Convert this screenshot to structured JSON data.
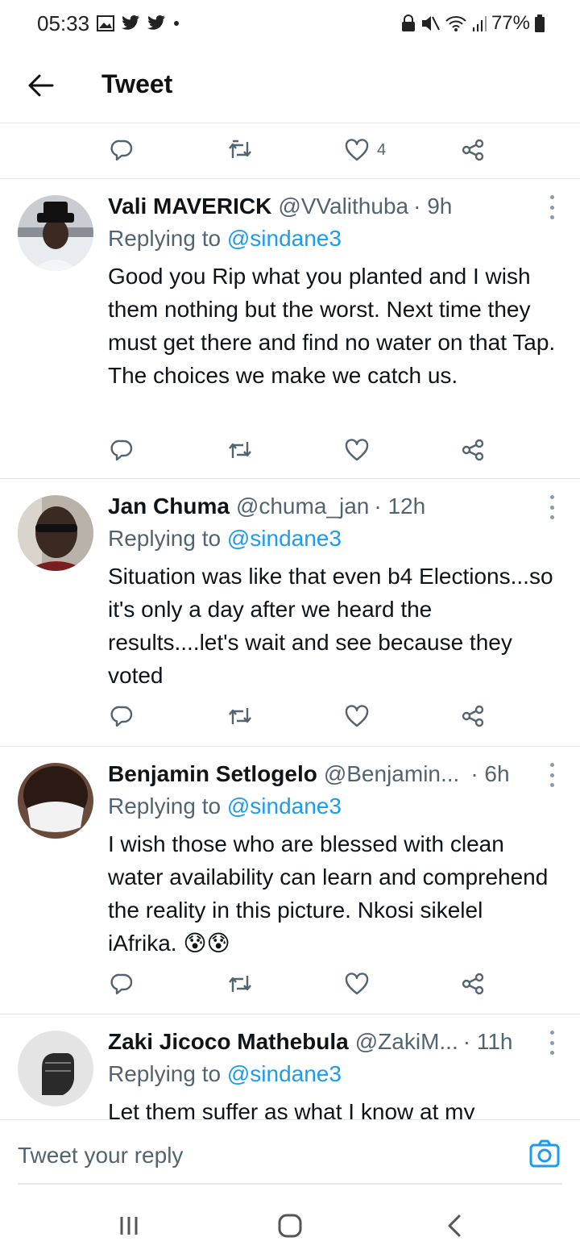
{
  "status": {
    "time": "05:33",
    "battery": "77%"
  },
  "header": {
    "title": "Tweet"
  },
  "top_actions": {
    "like_count": "4"
  },
  "tweets": [
    {
      "name": "Vali MAVERICK",
      "handle": "@VValithuba",
      "time": "· 9h",
      "replying_prefix": "Replying to ",
      "replying_to": "@sindane3",
      "text": "Good you Rip what you planted and I wish them nothing but the worst. Next time they must get there and find no water on that Tap. The choices we make we catch us."
    },
    {
      "name": "Jan Chuma",
      "handle": "@chuma_jan",
      "time": "· 12h",
      "replying_prefix": "Replying to ",
      "replying_to": "@sindane3",
      "text": "Situation was like that even b4 Elections...so it's only a day after we heard the results....let's wait and see because they voted"
    },
    {
      "name": "Benjamin Setlogelo",
      "handle": "@Benjamin...",
      "time": "· 6h",
      "replying_prefix": "Replying to ",
      "replying_to": "@sindane3",
      "text": "I wish those who are blessed with clean water availability can learn and comprehend the reality in this picture. Nkosi sikelel iAfrika. 😰😰"
    },
    {
      "name": "Zaki Jicoco Mathebula",
      "handle": "@ZakiM...",
      "time": "· 11h",
      "replying_prefix": "Replying to ",
      "replying_to": "@sindane3",
      "text": "Let them suffer as what I know at my"
    }
  ],
  "reply_bar": {
    "placeholder": "Tweet your reply"
  },
  "colors": {
    "accent": "#1d9bf0",
    "secondary_text": "#536471",
    "divider": "#e3e6e8"
  },
  "icons": [
    "back-arrow-icon",
    "reply-icon",
    "retweet-icon",
    "like-icon",
    "share-icon",
    "more-icon",
    "camera-icon",
    "nav-recents-icon",
    "nav-home-icon",
    "nav-back-icon"
  ]
}
